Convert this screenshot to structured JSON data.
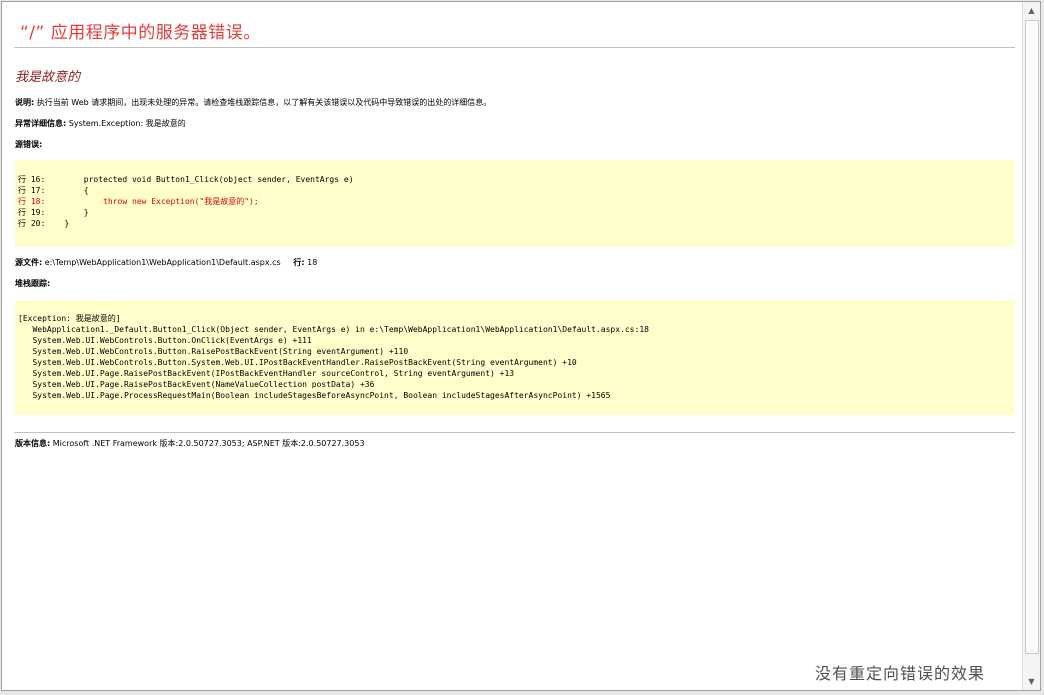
{
  "page_title": "“/” 应用程序中的服务器错误。",
  "error_message": "我是故意的",
  "description": {
    "label": "说明:",
    "text": "执行当前 Web 请求期间，出现未处理的异常。请检查堆栈跟踪信息，以了解有关该错误以及代码中导致错误的出处的详细信息。"
  },
  "exception_details": {
    "label": "异常详细信息:",
    "text": "System.Exception: 我是故意的"
  },
  "source_error": {
    "label": "源错误:",
    "lines": [
      {
        "prefix": "行 16:",
        "code": "        protected void Button1_Click(object sender, EventArgs e)",
        "is_error": false
      },
      {
        "prefix": "行 17:",
        "code": "        {",
        "is_error": false
      },
      {
        "prefix": "行 18:",
        "code": "            throw new Exception(\"我是故意的\");",
        "is_error": true
      },
      {
        "prefix": "行 19:",
        "code": "        }",
        "is_error": false
      },
      {
        "prefix": "行 20:",
        "code": "    }",
        "is_error": false
      }
    ]
  },
  "source_file": {
    "label": "源文件:",
    "path": "e:\\Temp\\WebApplication1\\WebApplication1\\Default.aspx.cs",
    "line_label": "行:",
    "line_number": "18"
  },
  "stack_trace": {
    "label": "堆栈跟踪:",
    "lines": [
      "[Exception: 我是故意的]",
      "   WebApplication1._Default.Button1_Click(Object sender, EventArgs e) in e:\\Temp\\WebApplication1\\WebApplication1\\Default.aspx.cs:18",
      "   System.Web.UI.WebControls.Button.OnClick(EventArgs e) +111",
      "   System.Web.UI.WebControls.Button.RaisePostBackEvent(String eventArgument) +110",
      "   System.Web.UI.WebControls.Button.System.Web.UI.IPostBackEventHandler.RaisePostBackEvent(String eventArgument) +10",
      "   System.Web.UI.Page.RaisePostBackEvent(IPostBackEventHandler sourceControl, String eventArgument) +13",
      "   System.Web.UI.Page.RaisePostBackEvent(NameValueCollection postData) +36",
      "   System.Web.UI.Page.ProcessRequestMain(Boolean includeStagesBeforeAsyncPoint, Boolean includeStagesAfterAsyncPoint) +1565"
    ]
  },
  "version_info": {
    "label": "版本信息:",
    "text": "Microsoft .NET Framework 版本:2.0.50727.3053; ASP.NET 版本:2.0.50727.3053"
  },
  "caption": "没有重定向错误的效果",
  "colors": {
    "title": "#e53b3b",
    "error_message": "#8f1d1d",
    "code_background": "#ffffcc",
    "error_line": "#e00000"
  },
  "icons": {
    "scroll_up": "scroll-up-arrow",
    "scroll_down": "scroll-down-arrow"
  }
}
